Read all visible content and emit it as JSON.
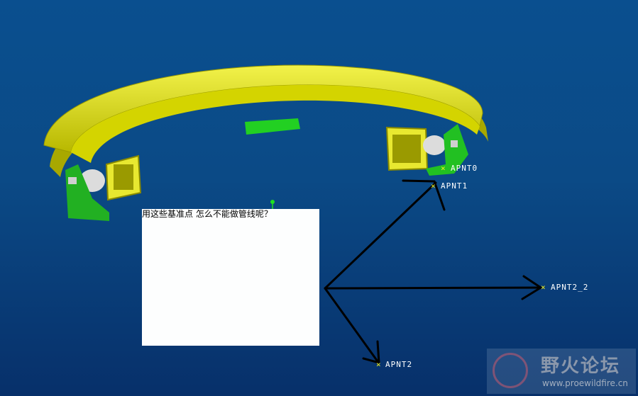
{
  "viewport": {
    "background": "#0a4f8f"
  },
  "note": {
    "text": "用这些基准点 怎么不能做管线呢？"
  },
  "datum_points": [
    {
      "name": "APNT0"
    },
    {
      "name": "APNT1"
    },
    {
      "name": "APNT2_2"
    },
    {
      "name": "APNT2"
    }
  ],
  "watermark": {
    "title": "野火论坛",
    "url": "www.proewildfire.cn"
  },
  "colors": {
    "ring": "#e0e020",
    "bracket": "#20c020",
    "arrow": "#000000",
    "datum_mark": "#f0f020"
  }
}
